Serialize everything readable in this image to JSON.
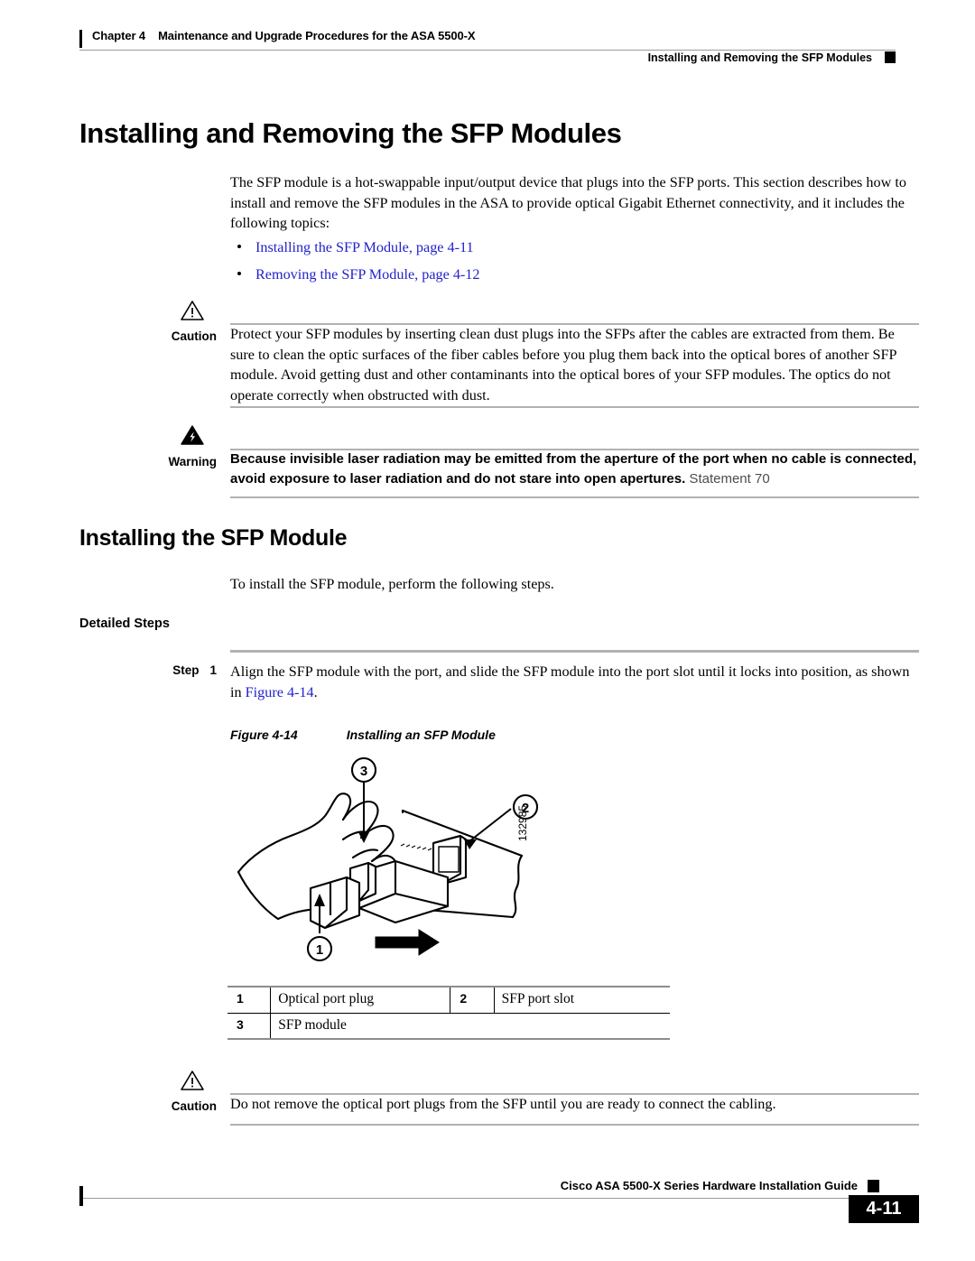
{
  "header": {
    "chapter_label": "Chapter 4",
    "chapter_title": "Maintenance and Upgrade Procedures for the ASA 5500-X",
    "section_title": "Installing and Removing the SFP Modules"
  },
  "main": {
    "title": "Installing and Removing the SFP Modules",
    "intro": "The SFP module is a hot-swappable input/output device that plugs into the SFP ports. This section describes how to install and remove the SFP modules in the ASA to provide optical Gigabit Ethernet connectivity, and it includes the following topics:",
    "topic_links": [
      "Installing the SFP Module, page 4-11",
      "Removing the SFP Module, page 4-12"
    ],
    "caution_top": {
      "label": "Caution",
      "icon": "caution-triangle-icon",
      "text": "Protect your SFP modules by inserting clean dust plugs into the SFPs after the cables are extracted from them. Be sure to clean the optic surfaces of the fiber cables before you plug them back into the optical bores of another SFP module. Avoid getting dust and other contaminants into the optical bores of your SFP modules. The optics do not operate correctly when obstructed with dust."
    },
    "warning": {
      "label": "Warning",
      "icon": "warning-lightning-icon",
      "text_bold": "Because invisible laser radiation may be emitted from the aperture of the port when no cable is connected, avoid exposure to laser radiation and do not stare into open apertures.",
      "statement": " Statement 70"
    },
    "section2_title": "Installing the SFP Module",
    "section2_intro": "To install the SFP module, perform the following steps.",
    "detailed_steps_label": "Detailed Steps",
    "step": {
      "label": "Step",
      "number": "1",
      "text_before": "Align the SFP module with the port, and slide the SFP module into the port slot until it locks into position, as shown in ",
      "xref": "Figure 4-14",
      "text_after": "."
    },
    "figure": {
      "label": "Figure 4-14",
      "title": "Installing an SFP Module",
      "art_number": "132985",
      "callouts": [
        "1",
        "2",
        "3"
      ]
    },
    "legend": {
      "rows": [
        {
          "num": "1",
          "text": "Optical port plug",
          "num2": "2",
          "text2": "SFP port slot"
        },
        {
          "num": "3",
          "text": "SFP module",
          "num2": "",
          "text2": ""
        }
      ]
    },
    "caution_bottom": {
      "label": "Caution",
      "icon": "caution-triangle-icon",
      "text": "Do not remove the optical port plugs from the SFP until you are ready to connect the cabling."
    }
  },
  "footer": {
    "guide_title": "Cisco ASA 5500-X Series Hardware Installation Guide",
    "page_number": "4-11"
  },
  "colors": {
    "link": "#2222cc",
    "rule": "#b2b2b2",
    "text": "#000000"
  }
}
